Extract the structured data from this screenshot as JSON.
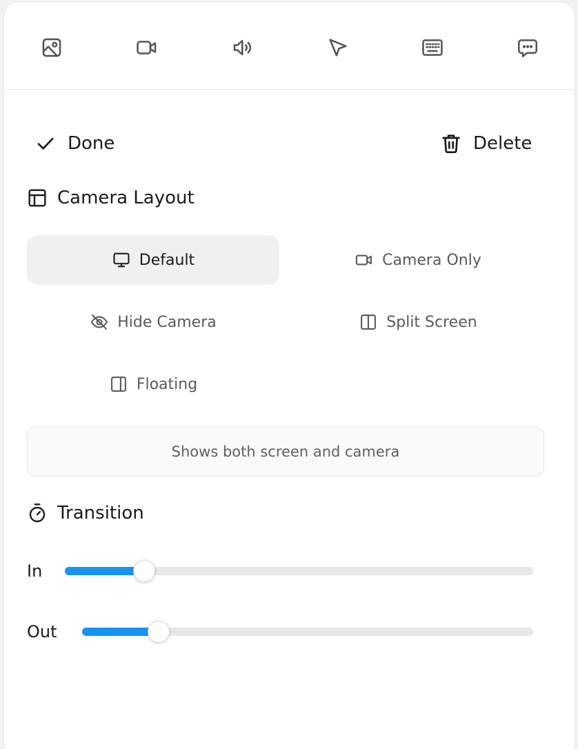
{
  "toolbar": {
    "icons": [
      "image-icon",
      "video-icon",
      "volume-icon",
      "cursor-icon",
      "keyboard-icon",
      "chat-icon"
    ]
  },
  "actions": {
    "done_label": "Done",
    "delete_label": "Delete"
  },
  "camera_layout": {
    "title": "Camera Layout",
    "options": [
      {
        "label": "Default",
        "icon": "monitor-icon",
        "selected": true
      },
      {
        "label": "Camera Only",
        "icon": "video-icon",
        "selected": false
      },
      {
        "label": "Hide Camera",
        "icon": "eye-off-icon",
        "selected": false
      },
      {
        "label": "Split Screen",
        "icon": "split-columns-icon",
        "selected": false
      },
      {
        "label": "Floating",
        "icon": "panel-right-icon",
        "selected": false
      }
    ],
    "description": "Shows both screen and camera"
  },
  "transition": {
    "title": "Transition",
    "in": {
      "label": "In",
      "value_fraction": 0.17
    },
    "out": {
      "label": "Out",
      "value_fraction": 0.17
    }
  },
  "colors": {
    "accent": "#1592f2",
    "selected_bg": "#f0f0f0"
  }
}
